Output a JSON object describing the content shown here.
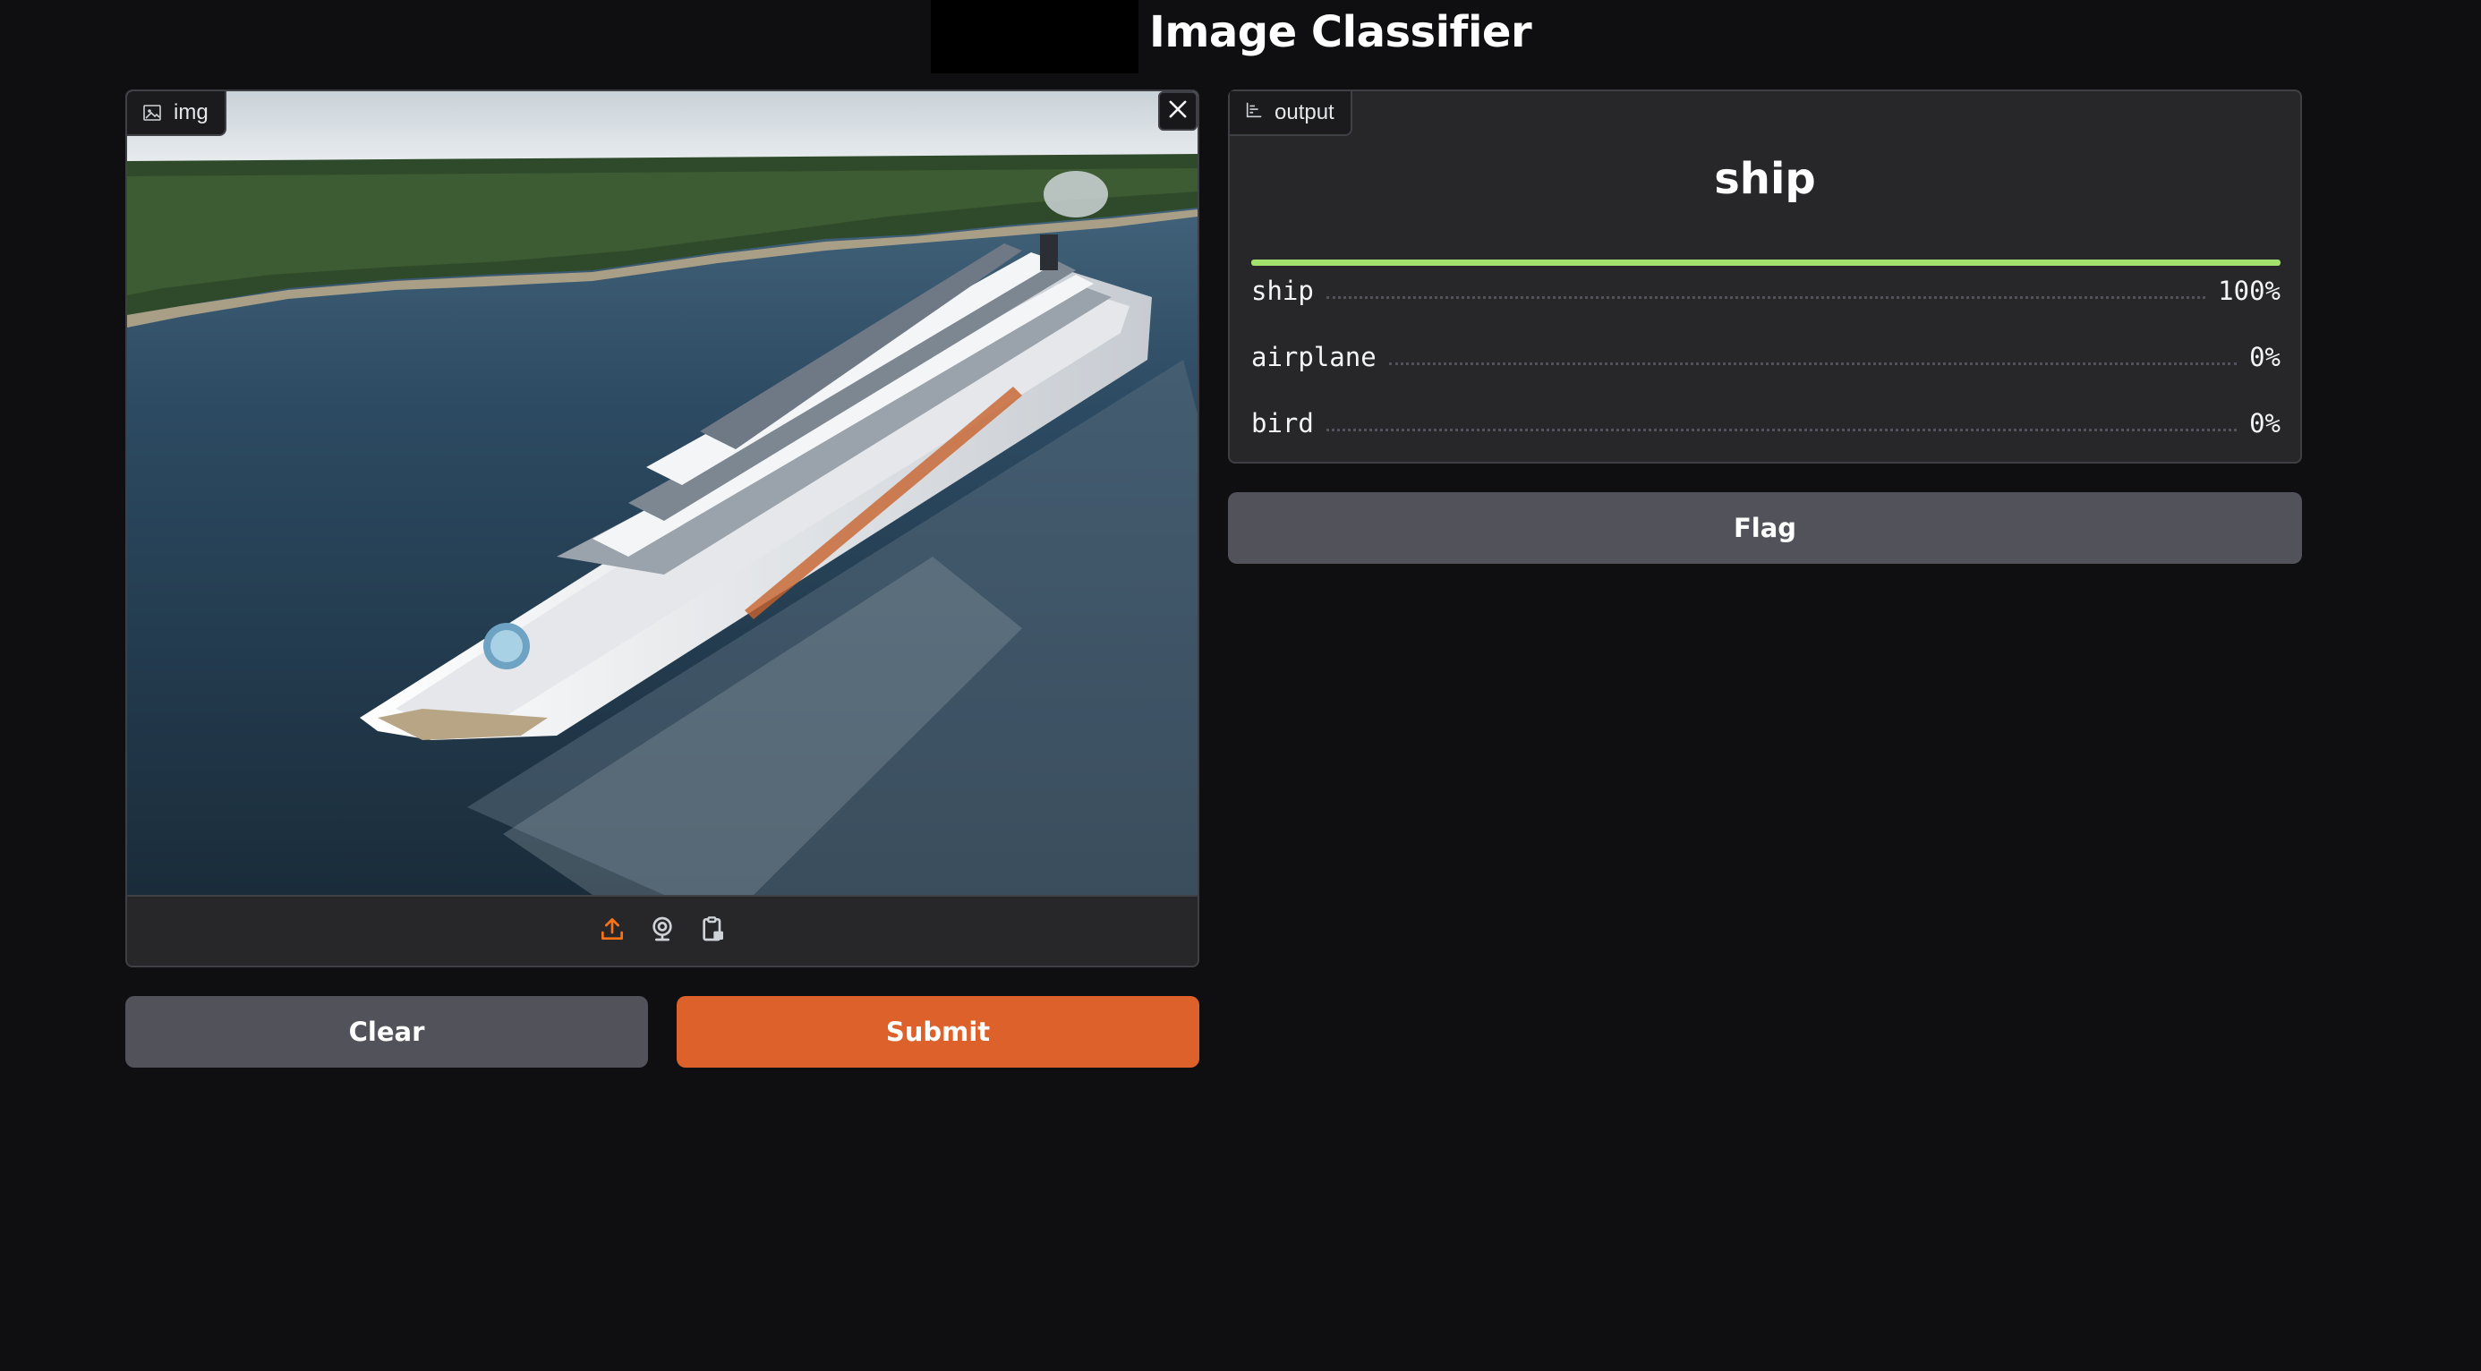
{
  "header": {
    "title": "Image Classifier"
  },
  "input": {
    "label": "img",
    "label_icon": "image-icon",
    "close_icon": "close-icon",
    "tools": [
      "upload-icon",
      "webcam-icon",
      "clipboard-icon"
    ],
    "accent_color": "#f97316"
  },
  "actions": {
    "clear_label": "Clear",
    "submit_label": "Submit",
    "flag_label": "Flag"
  },
  "output": {
    "label": "output",
    "label_icon": "bar-chart-icon",
    "top_label": "ship",
    "confidences": [
      {
        "label": "ship",
        "value_text": "100%",
        "value": 1.0
      },
      {
        "label": "airplane",
        "value_text": "0%",
        "value": 0.0
      },
      {
        "label": "bird",
        "value_text": "0%",
        "value": 0.0
      }
    ],
    "bar_color": "#a3e16f"
  },
  "colors": {
    "submit": "#dd612b",
    "secondary": "#52525b",
    "background": "#0f0f11"
  }
}
